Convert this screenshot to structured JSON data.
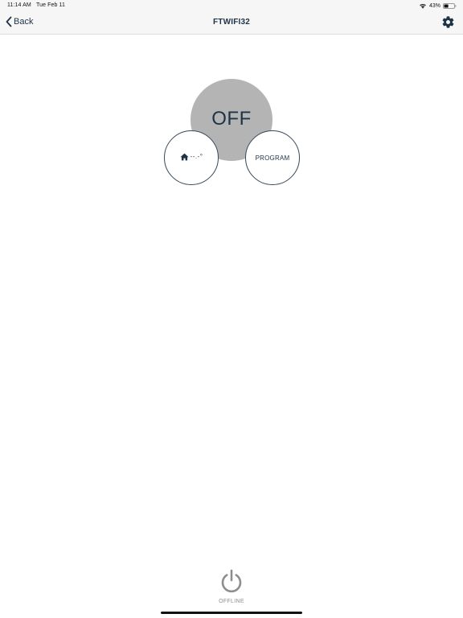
{
  "status_bar": {
    "time": "11:14 AM",
    "date": "Tue Feb 11",
    "battery_percent": "43%",
    "battery_level": 0.43,
    "wifi_icon": "wifi-icon",
    "battery_icon": "battery-icon"
  },
  "nav": {
    "back_label": "Back",
    "back_icon": "chevron-left-icon",
    "title": "FTWIFI32",
    "settings_icon": "gear-icon"
  },
  "thermostat": {
    "mode_label": "OFF",
    "temperature": "--.-°",
    "home_icon": "home-icon",
    "program_label": "PROGRAM"
  },
  "footer": {
    "power_icon": "power-icon",
    "connection_status": "OFFLINE"
  },
  "colors": {
    "primary": "#1e3346",
    "mode_circle": "#b4b4b4",
    "power_icon": "#8e8e8e",
    "bar_background": "#f6f6f7"
  }
}
